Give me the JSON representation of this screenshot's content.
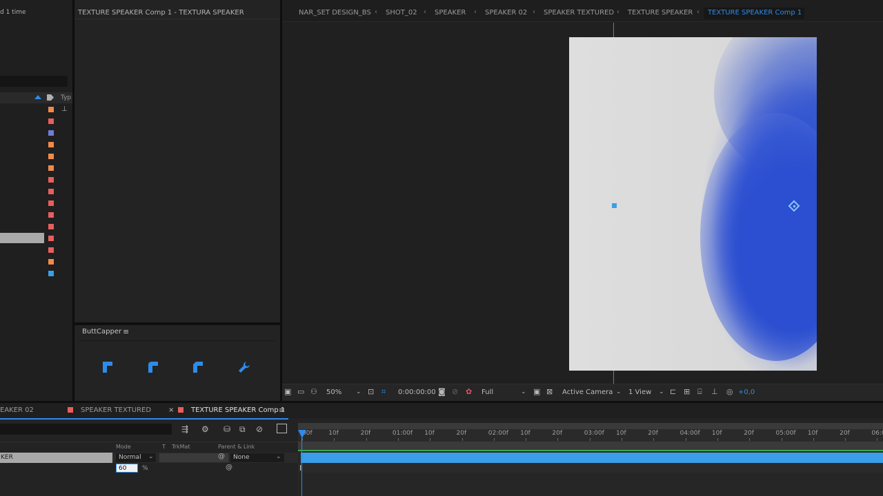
{
  "project_panel": {
    "render_label": "d 1 time",
    "type_column": "Typ",
    "swatches": [
      "#f08a4b",
      "#e85e5e",
      "#6f7dd6",
      "#f08a4b",
      "#f08a4b",
      "#f08a4b",
      "#e85e5e",
      "#e85e5e",
      "#e85e5e",
      "#e85e5e",
      "#e85e5e",
      "#e85e5e",
      "#e85e5e",
      "#f08a4b",
      "#3a9ee8"
    ]
  },
  "layer_panel": {
    "title": "TEXTURE SPEAKER Comp 1 - TEXTURA SPEAKER"
  },
  "buttcapper": {
    "title": "ButtCapper",
    "menu_icon": "hamburger-icon",
    "icons": [
      "butt-cap-icon",
      "round-cap-icon",
      "projecting-cap-icon",
      "wrench-icon"
    ]
  },
  "breadcrumbs": [
    "NAR_SET DESIGN_BS",
    "SHOT_02",
    "SPEAKER",
    "SPEAKER 02",
    "SPEAKER TEXTURED",
    "TEXTURE SPEAKER",
    "TEXTURE SPEAKER Comp 1"
  ],
  "viewer_toolbar": {
    "zoom": "50%",
    "timecode": "0:00:00:00",
    "resolution": "Full",
    "camera": "Active Camera",
    "views": "1 View",
    "exposure": "+0,0"
  },
  "timeline_tabs": [
    {
      "label": "EAKER 02",
      "color": "#e85e5e"
    },
    {
      "label": "SPEAKER TEXTURED",
      "color": "#e85e5e"
    },
    {
      "label": "TEXTURE SPEAKER Comp 1",
      "color": "#e85e5e",
      "active": true,
      "close": "×",
      "menu": "≡"
    }
  ],
  "timeline_columns": {
    "mode": "Mode",
    "t": "T",
    "trkmat": "TrkMat",
    "parent": "Parent & Link"
  },
  "layer_row": {
    "name": "KER",
    "mode": "Normal",
    "parent": "None",
    "opacity_value": "60",
    "opacity_unit": "%"
  },
  "ruler_ticks": [
    "00f",
    "10f",
    "20f",
    "01:00f",
    "10f",
    "20f",
    "02:00f",
    "10f",
    "20f",
    "03:00f",
    "10f",
    "20f",
    "04:00f",
    "10f",
    "20f",
    "05:00f",
    "10f",
    "20f",
    "06:0"
  ],
  "colors": {
    "accent": "#2d8ceb",
    "layer_bar": "#3a9ee8",
    "composition_blue": "#2b4fd0",
    "composition_bg": "#dcdcdc"
  }
}
